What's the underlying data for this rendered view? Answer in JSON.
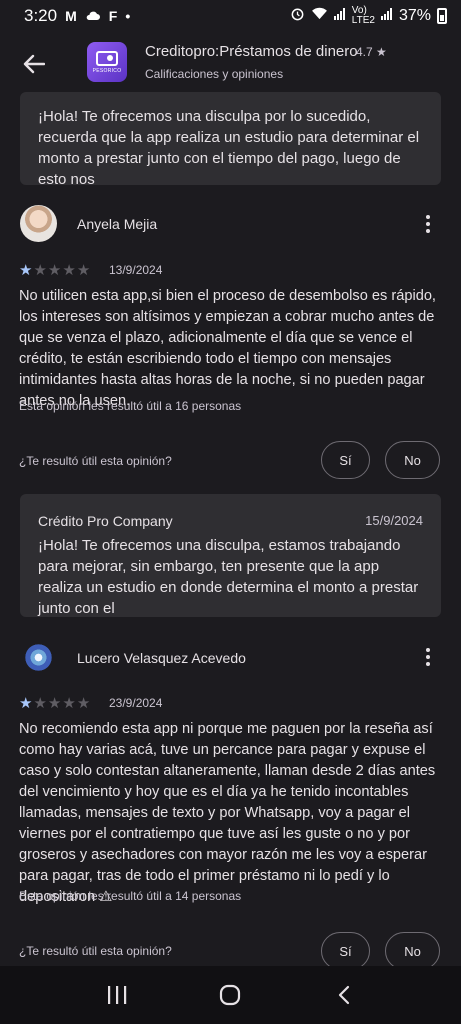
{
  "status_bar": {
    "time": "3:20",
    "left_icons": [
      "M",
      "F",
      "•"
    ],
    "net_top": "Vo)",
    "net_bottom": "LTE2",
    "battery": "37%"
  },
  "header": {
    "title": "Creditopro:Préstamos de dinero",
    "rating": "4.7 ★",
    "subtitle": "Calificaciones y opiniones",
    "icon_brand": "PESORICO"
  },
  "top_reply": {
    "text": "¡Hola! Te ofrecemos una disculpa por lo sucedido, recuerda que la app realiza un estudio para determinar el monto a prestar junto con el tiempo del pago, luego de esto nos"
  },
  "reviews": [
    {
      "name": "Anyela Mejia",
      "rating": 1,
      "date": "13/9/2024",
      "text": "No utilicen esta app,si bien el proceso de desembolso es rápido, los intereses son altísimos y empiezan a cobrar mucho antes de que se venza el plazo, adicionalmente el día que se vence el crédito, te están escribiendo todo el tiempo con mensajes intimidantes hasta altas horas de la noche, si no pueden pagar antes no la usen.",
      "helpful": "Esta opinión les resultó útil a 16 personas",
      "question": "¿Te resultó útil esta opinión?",
      "yes": "Sí",
      "no": "No",
      "reply": {
        "author": "Crédito Pro Company",
        "date": "15/9/2024",
        "text": "¡Hola! Te ofrecemos una disculpa, estamos trabajando para mejorar, sin embargo, ten presente que la app realiza un estudio en donde determina el monto a prestar junto con el"
      }
    },
    {
      "name": "Lucero Velasquez Acevedo",
      "rating": 1,
      "date": "23/9/2024",
      "text": "No recomiendo esta app ni porque me paguen por la reseña así como hay varias acá, tuve un percance para pagar y expuse el caso y solo contestan altaneramente, llaman desde 2 días antes del vencimiento y hoy que es el día ya he tenido incontables llamadas, mensajes de texto y por Whatsapp, voy a pagar el viernes por el contratiempo que tuve así les guste o no y por groseros y asechadores con mayor razón me les voy a esperar para pagar, tras de todo el primer préstamo ni lo pedí y lo depositaron ⚠",
      "helpful": "Esta opinión les resultó útil a 14 personas",
      "question": "¿Te resultó útil esta opinión?",
      "yes": "Sí",
      "no": "No"
    }
  ],
  "colors": {
    "background": "#1c1b1f",
    "reply_box": "#2f2e32",
    "star_filled": "#a8c7fa",
    "star_empty": "#5f5d63"
  }
}
